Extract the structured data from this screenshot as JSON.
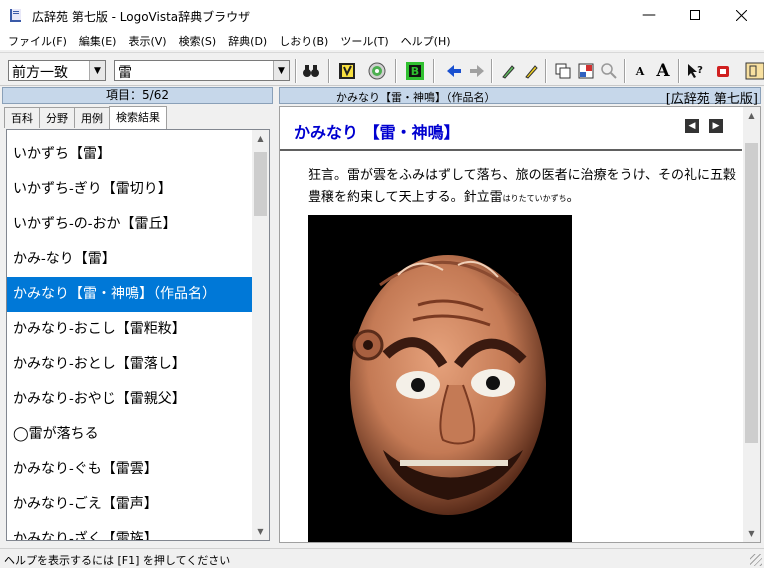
{
  "window": {
    "title": "広辞苑 第七版 - LogoVista辞典ブラウザ"
  },
  "menu": [
    "ファイル(F)",
    "編集(E)",
    "表示(V)",
    "検索(S)",
    "辞典(D)",
    "しおり(B)",
    "ツール(T)",
    "ヘルプ(H)"
  ],
  "toolbar": {
    "mode_value": "前方一致",
    "search_value": "雷",
    "font_small_label": "A",
    "font_large_label": "A"
  },
  "left": {
    "header": "項目：5/62",
    "tabs": [
      "百科",
      "分野",
      "用例",
      "検索結果"
    ],
    "active_tab": "検索結果",
    "items": [
      "いかずち【雷】",
      "いかずち‐ぎり【雷切り】",
      "いかずち‐の‐おか【雷丘】",
      "かみ‐なり【雷】",
      "かみなり【雷・神鳴】（作品名）",
      "かみなり‐おこし【雷粔籹】",
      "かみなり‐おとし【雷落し】",
      "かみなり‐おやじ【雷親父】",
      "◯雷が落ちる",
      "かみなり‐ぐも【雷雲】",
      "かみなり‐ごえ【雷声】",
      "かみなり‐ざく【雷族】"
    ],
    "selected_index": 4
  },
  "right": {
    "header_title": "かみなり【雷・神鳴】（作品名）",
    "header_dict": "[広辞苑 第七版]",
    "entry_title": "かみなり 【雷・神鳴】",
    "body_text": "狂言。雷が雲をふみはずして落ち、旅の医者に治療をうけ、その礼に五穀豊穣を約束して天上する。針立雷",
    "ruby": "はりたていかずち",
    "body_end": "。"
  },
  "status": {
    "text": "ヘルプを表示するには [F1] を押してください"
  },
  "colors": {
    "selection": "#0078d7",
    "entry_title": "#0000d0",
    "pane_header": "#c6d7ea"
  }
}
